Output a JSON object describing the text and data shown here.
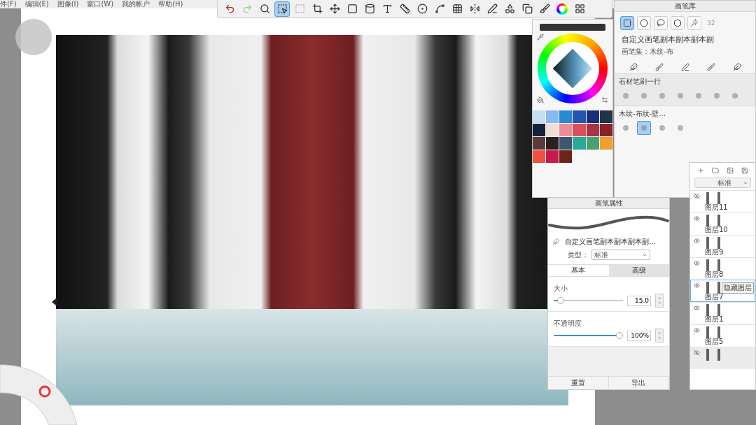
{
  "menu": [
    "件(F)",
    "编辑(E)",
    "图像(I)",
    "窗口(W)",
    "我的帐户",
    "帮助(H)"
  ],
  "toolbar": [
    {
      "kind": "undo",
      "selected": false
    },
    {
      "kind": "redo",
      "selected": false
    },
    {
      "kind": "zoom",
      "selected": false
    },
    {
      "kind": "select",
      "selected": true
    },
    {
      "kind": "deselect",
      "selected": false
    },
    {
      "kind": "crop",
      "selected": false
    },
    {
      "kind": "move",
      "selected": false
    },
    {
      "kind": "distort",
      "selected": false
    },
    {
      "kind": "fill",
      "selected": false
    },
    {
      "kind": "text",
      "selected": false
    },
    {
      "kind": "ruler",
      "selected": false
    },
    {
      "kind": "ellipse",
      "selected": false
    },
    {
      "kind": "curve",
      "selected": false
    },
    {
      "kind": "perspective",
      "selected": false
    },
    {
      "kind": "symmetry",
      "selected": false
    },
    {
      "kind": "stroke",
      "selected": false
    },
    {
      "kind": "shapes",
      "selected": false
    },
    {
      "kind": "copy",
      "selected": false
    },
    {
      "kind": "brushes",
      "selected": false
    },
    {
      "kind": "color",
      "selected": false
    },
    {
      "kind": "palette",
      "selected": false
    }
  ],
  "color_panel": {
    "swatches": [
      {
        "color": "#c5def0"
      },
      {
        "color": "#8ab8f0"
      },
      {
        "color": "#2a8ad0"
      },
      {
        "color": "#2456b0"
      },
      {
        "color": "#1a2f7a"
      },
      {
        "color": "#1f3548"
      },
      {
        "color": "#14213d"
      },
      {
        "color": "#f0ddd5"
      },
      {
        "color": "#e98d98"
      },
      {
        "color": "#d8505e"
      },
      {
        "color": "#a83448"
      },
      {
        "color": "#8b1f2a"
      },
      {
        "color": "#5a3a3a"
      },
      {
        "color": "#2d1f1c"
      },
      {
        "color": "#3f5470"
      },
      {
        "color": "#2aa898"
      },
      {
        "color": "#4aa070"
      },
      {
        "color": "#f0a030"
      },
      {
        "color": "#f05040"
      },
      {
        "color": "#c8184e"
      },
      {
        "color": "#6a2418"
      }
    ]
  },
  "brush_library": {
    "title": "画笔库",
    "selection_tools": [
      {
        "kind": "rect",
        "selected": true
      },
      {
        "kind": "ellipse",
        "selected": false
      },
      {
        "kind": "lasso",
        "selected": false
      },
      {
        "kind": "polygon",
        "selected": false
      },
      {
        "kind": "wand",
        "selected": false
      }
    ],
    "size_value": "32",
    "brush_name": "自定义画笔副本副本副本副",
    "brush_set": "画笔集：木纹-布",
    "sections": [
      {
        "title": "石材笔刷一行",
        "brushes": [
          {
            "selected": false
          },
          {
            "selected": false
          },
          {
            "selected": false
          },
          {
            "selected": false
          },
          {
            "selected": false
          },
          {
            "selected": false
          },
          {
            "selected": false
          }
        ]
      },
      {
        "title": "木纹-布纹-壁…",
        "brushes": [
          {
            "selected": false
          },
          {
            "selected": true
          },
          {
            "selected": false
          },
          {
            "selected": false
          }
        ]
      }
    ]
  },
  "brush_properties": {
    "title": "画笔属性",
    "brush_name": "自定义画笔副本副本副本副…",
    "type_label": "类型：",
    "type_value": "标准",
    "tabs": [
      {
        "label": "基本",
        "selected": true
      },
      {
        "label": "高级",
        "selected": false
      }
    ],
    "sliders": [
      {
        "label": "大小",
        "level": 0.06,
        "value": "15.0"
      },
      {
        "label": "不透明度",
        "level": 1,
        "value": "100%"
      }
    ],
    "buttons": [
      "重置",
      "导出"
    ]
  },
  "layers": {
    "blend_mode": "标准",
    "tooltip": "隐藏图层",
    "items": [
      {
        "name": "图层11",
        "visible": false,
        "selected": false
      },
      {
        "name": "图层10",
        "visible": true,
        "selected": false
      },
      {
        "name": "图层9",
        "visible": true,
        "selected": false
      },
      {
        "name": "图层8",
        "visible": true,
        "selected": false
      },
      {
        "name": "图层7",
        "visible": true,
        "selected": true
      },
      {
        "name": "图层1",
        "visible": true,
        "selected": false
      },
      {
        "name": "图层5",
        "visible": true,
        "selected": false
      },
      {
        "visible": false,
        "selected": false
      }
    ]
  }
}
